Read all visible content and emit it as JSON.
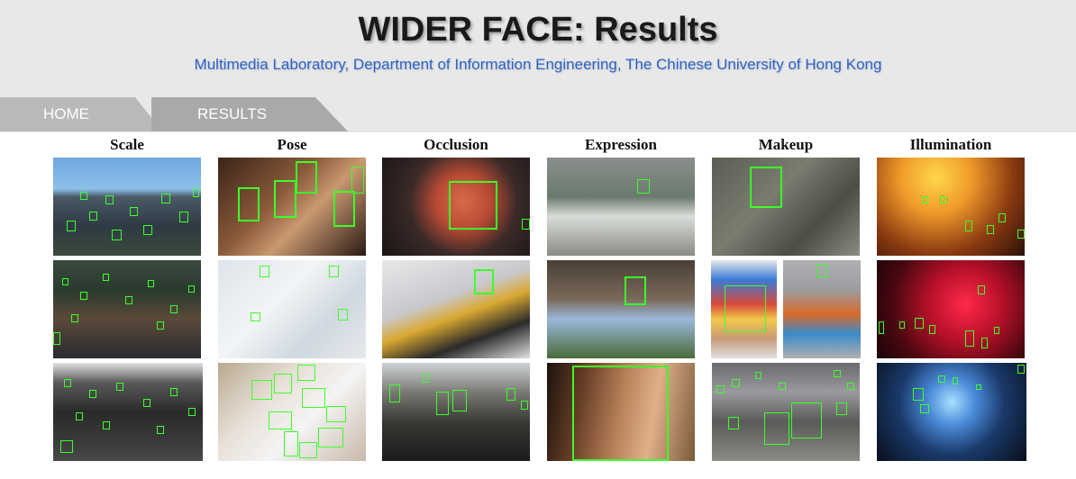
{
  "header": {
    "title": "WIDER FACE: Results",
    "subtitle": "Multimedia Laboratory, Department of Information Engineering, The Chinese University of Hong Kong"
  },
  "nav": {
    "tabs": [
      {
        "label": "HOME"
      },
      {
        "label": "RESULTS"
      }
    ]
  },
  "grid": {
    "columns": [
      {
        "label": "Scale"
      },
      {
        "label": "Pose"
      },
      {
        "label": "Occlusion"
      },
      {
        "label": "Expression"
      },
      {
        "label": "Makeup"
      },
      {
        "label": "Illumination"
      }
    ]
  },
  "colors": {
    "header_bg": "#e8e8e8",
    "subtitle": "#2a62c9",
    "tab_home": "#b9b9b9",
    "tab_results": "#a9a9a9",
    "face_box": "#3cff2a"
  }
}
